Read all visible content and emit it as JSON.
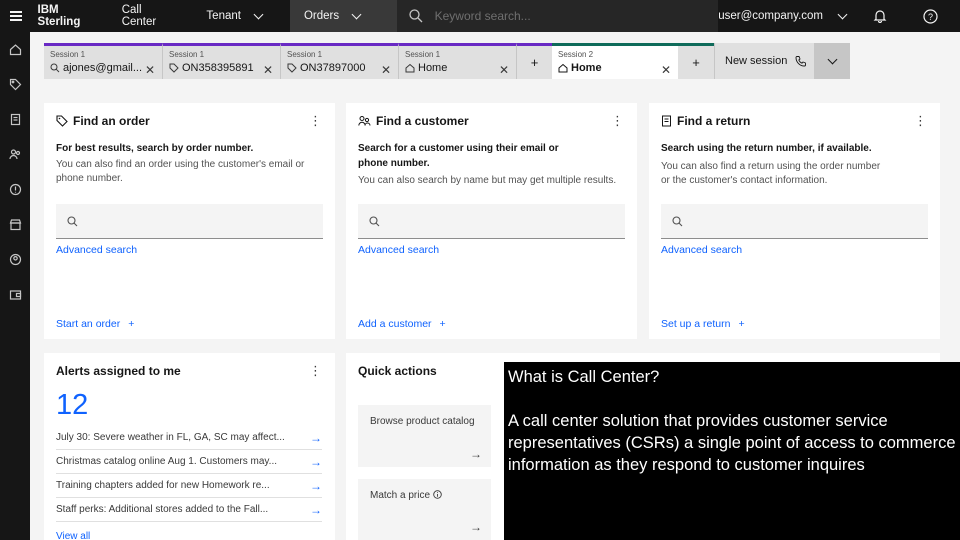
{
  "header": {
    "brand": "IBM Sterling",
    "product": "Call Center",
    "tenant_label": "Tenant",
    "menu_label": "Orders",
    "search_placeholder": "Keyword search...",
    "user_email": "user@company.com"
  },
  "tabs": [
    {
      "session": "Session 1",
      "label": "ajones@gmail...",
      "icon": "search-icon"
    },
    {
      "session": "Session 1",
      "label": "ON358395891",
      "icon": "tag-icon"
    },
    {
      "session": "Session 1",
      "label": "ON37897000",
      "icon": "tag-icon"
    },
    {
      "session": "Session 1",
      "label": "Home",
      "icon": "home-icon"
    }
  ],
  "active_tab": {
    "session": "Session 2",
    "label": "Home",
    "icon": "home-icon"
  },
  "tab_plus": "+",
  "new_session_label": "New session",
  "cards": {
    "order": {
      "title": "Find an order",
      "bold": "For best results, search by order number.",
      "text": "You can also find an order using the customer's email or phone number.",
      "advanced": "Advanced search",
      "action": "Start an order"
    },
    "customer": {
      "title": "Find a customer",
      "bold": "Search for a customer using their email or phone number.",
      "text": "You can also search by name but may get multiple results.",
      "advanced": "Advanced search",
      "action": "Add a customer"
    },
    "return": {
      "title": "Find a return",
      "bold": "Search using the return number, if available.",
      "text": "You can also find a return using the order number or the customer's contact information.",
      "advanced": "Advanced search",
      "action": "Set up a return"
    }
  },
  "alerts": {
    "title": "Alerts assigned to me",
    "count": "12",
    "items": [
      "July 30: Severe weather in FL, GA, SC may affect...",
      "Christmas catalog online Aug 1. Customers may...",
      "Training chapters added for new Homework re...",
      "Staff perks: Additional stores added to the Fall..."
    ],
    "view_all": "View all"
  },
  "quick_actions": {
    "title": "Quick actions",
    "tiles": [
      "Browse product catalog",
      "Match a price"
    ]
  },
  "overlay": {
    "heading": "What is Call Center?",
    "body": "A call center solution that provides customer service representatives (CSRs) a single point of access to commerce information as they respond to customer inquires"
  },
  "colors": {
    "header_bg": "#161616",
    "tab_accent_session1": "#6929c4",
    "tab_accent_session2": "#0f6b5a",
    "link": "#0f62fe"
  }
}
